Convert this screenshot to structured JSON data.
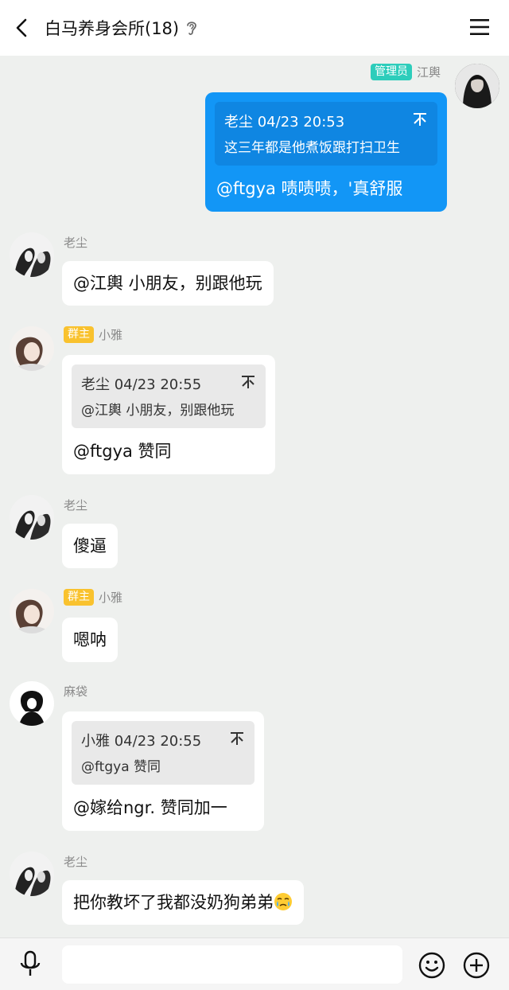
{
  "header": {
    "title": "白马养身会所(18)"
  },
  "messages": [
    {
      "sender": "江輿",
      "role_badge": "管理员",
      "quote": {
        "author_time": "老尘 04/23 20:53",
        "text": "这三年都是他煮饭跟打扫卫生"
      },
      "text": "@ftgya 啧啧啧，'真舒服"
    },
    {
      "sender": "老尘",
      "text": "@江輿 小朋友，别跟他玩"
    },
    {
      "sender": "小雅",
      "role_badge": "群主",
      "quote": {
        "author_time": "老尘 04/23 20:55",
        "text": "@江輿 小朋友，别跟他玩"
      },
      "text": "@ftgya 赞同"
    },
    {
      "sender": "老尘",
      "text": "傻逼"
    },
    {
      "sender": "小雅",
      "role_badge": "群主",
      "text": "嗯呐"
    },
    {
      "sender": "麻袋",
      "quote": {
        "author_time": "小雅 04/23 20:55",
        "text": "@ftgya 赞同"
      },
      "text": "@嫁给ngr. 赞同加一"
    },
    {
      "sender": "老尘",
      "text": "把你教坏了我都没奶狗弟弟"
    }
  ],
  "icons": {
    "back": "chevron-left-icon",
    "ear": "ear-icon",
    "menu": "menu-icon",
    "pin": "pin-icon",
    "emoji": "crying-face-emoji",
    "mic": "microphone-icon",
    "smile": "smiley-icon",
    "plus": "plus-circle-icon"
  },
  "colors": {
    "my_bubble": "#1296f6",
    "admin_badge": "#2dcdbb",
    "owner_badge": "#f9c22e",
    "background": "#eef0ee"
  },
  "input": {
    "value": "",
    "placeholder": ""
  }
}
